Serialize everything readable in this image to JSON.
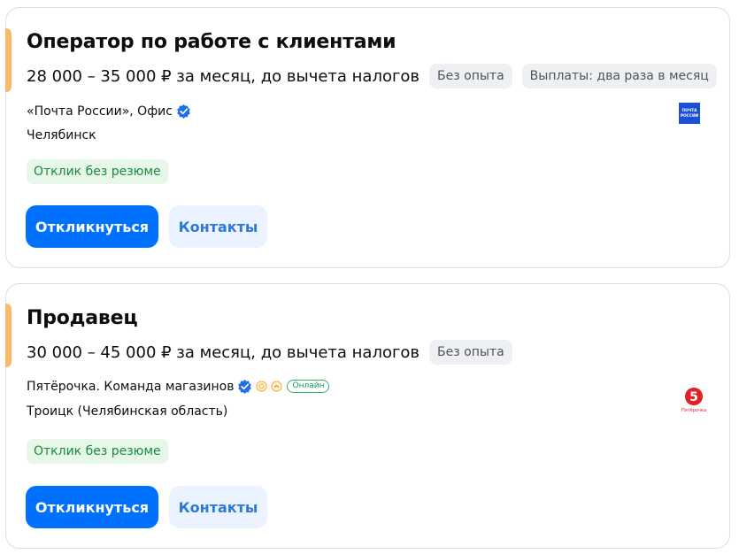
{
  "vacancies": [
    {
      "title": "Оператор по работе с клиентами",
      "salary": "28 000 – 35 000 ₽ за месяц, до вычета налогов",
      "tags": [
        "Без опыта",
        "Выплаты: два раза в месяц"
      ],
      "company": "«Почта России», Офис",
      "city": "Челябинск",
      "no_resume_label": "Отклик без резюме",
      "apply_label": "Откликнуться",
      "contacts_label": "Контакты",
      "logo_text": [
        "ПОЧТА",
        "РОССИИ"
      ]
    },
    {
      "title": "Продавец",
      "salary": "30 000 – 45 000 ₽ за месяц, до вычета налогов",
      "tags": [
        "Без опыта"
      ],
      "company": "Пятёрочка. Команда магазинов",
      "online_badge": "Онлайн",
      "city": "Троицк (Челябинская область)",
      "no_resume_label": "Отклик без резюме",
      "apply_label": "Откликнуться",
      "contacts_label": "Контакты",
      "logo_text": [
        "5",
        "Пятёрочка"
      ]
    }
  ],
  "colors": {
    "accent_bar": "#f7b96a",
    "primary_button": "#0070ff",
    "secondary_button": "#eaf3ff",
    "no_resume_bg": "#e7f7ea",
    "verified": "#1f6fe8"
  },
  "icons": {
    "verified": "verified-check-icon",
    "rating_badge": "rating-badge-icon",
    "bonus_badge": "bonus-badge-icon"
  }
}
